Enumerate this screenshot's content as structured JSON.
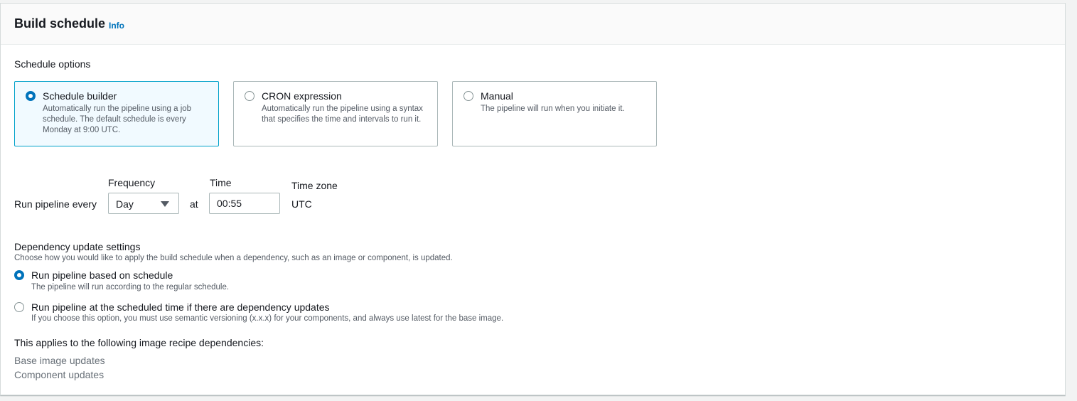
{
  "header": {
    "title": "Build schedule",
    "info": "Info"
  },
  "schedule_options": {
    "label": "Schedule options",
    "tiles": [
      {
        "title": "Schedule builder",
        "description": "Automatically run the pipeline using a job schedule. The default schedule is every Monday at 9:00 UTC.",
        "selected": true
      },
      {
        "title": "CRON expression",
        "description": "Automatically run the pipeline using a syntax that specifies the time and intervals to run it.",
        "selected": false
      },
      {
        "title": "Manual",
        "description": "The pipeline will run when you initiate it.",
        "selected": false
      }
    ]
  },
  "run_settings": {
    "run_label": "Run pipeline every",
    "frequency_label": "Frequency",
    "frequency_value": "Day",
    "at_label": "at",
    "time_label": "Time",
    "time_value": "00:55",
    "timezone_label": "Time zone",
    "timezone_value": "UTC"
  },
  "dependency": {
    "title": "Dependency update settings",
    "description": "Choose how you would like to apply the build schedule when a dependency, such as an image or component, is updated.",
    "options": [
      {
        "label": "Run pipeline based on schedule",
        "description": "The pipeline will run according to the regular schedule.",
        "selected": true
      },
      {
        "label": "Run pipeline at the scheduled time if there are dependency updates",
        "description": "If you choose this option, you must use semantic versioning (x.x.x) for your components, and always use latest for the base image.",
        "selected": false
      }
    ]
  },
  "applies": {
    "label": "This applies to the following image recipe dependencies:",
    "items": [
      "Base image updates",
      "Component updates"
    ]
  },
  "colors": {
    "accent": "#0073bb",
    "selected_border": "#00a1c9",
    "selected_bg": "#f1faff"
  }
}
